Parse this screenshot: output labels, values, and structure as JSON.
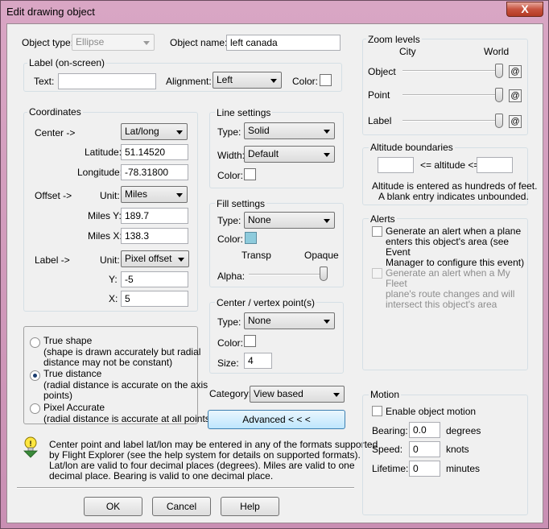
{
  "window": {
    "title": "Edit drawing object",
    "close_glyph": "X"
  },
  "object": {
    "type_label": "Object type:",
    "type_value": "Ellipse",
    "name_label": "Object name:",
    "name_value": "left canada"
  },
  "label_group": {
    "title": "Label (on-screen)",
    "text_label": "Text:",
    "text_value": "",
    "alignment_label": "Alignment:",
    "alignment_value": "Left",
    "color_label": "Color:"
  },
  "coordinates": {
    "title": "Coordinates",
    "center_label": "Center ->",
    "center_mode": "Lat/long",
    "latitude_label": "Latitude:",
    "latitude_value": "51.14520",
    "longitude_label": "Longitude:",
    "longitude_value": "-78.31800",
    "offset_label": "Offset ->",
    "unit_label": "Unit:",
    "offset_unit": "Miles",
    "miles_y_label": "Miles Y:",
    "miles_y_value": "189.7",
    "miles_x_label": "Miles X:",
    "miles_x_value": "138.3",
    "label_label": "Label ->",
    "label_unit": "Pixel offset",
    "y_label": "Y:",
    "y_value": "-5",
    "x_label": "X:",
    "x_value": "5"
  },
  "line_settings": {
    "title": "Line settings",
    "type_label": "Type:",
    "type_value": "Solid",
    "width_label": "Width:",
    "width_value": "Default",
    "color_label": "Color:"
  },
  "fill_settings": {
    "title": "Fill settings",
    "type_label": "Type:",
    "type_value": "None",
    "color_label": "Color:",
    "transp_label": "Transp",
    "opaque_label": "Opaque",
    "alpha_label": "Alpha:",
    "alpha_level": 1.0
  },
  "vertex": {
    "title": "Center / vertex point(s)",
    "type_label": "Type:",
    "type_value": "None",
    "color_label": "Color:",
    "size_label": "Size:",
    "size_value": "4"
  },
  "shape_mode": {
    "options": [
      {
        "title": "True shape",
        "desc1": "(shape is drawn accurately but radial",
        "desc2": "distance may not be constant)",
        "selected": false
      },
      {
        "title": "True distance",
        "desc1": "(radial distance is accurate on the axis",
        "desc2": "points)",
        "selected": true
      },
      {
        "title": "Pixel Accurate",
        "desc1": "(radial distance is accurate at all points)",
        "desc2": "",
        "selected": false
      }
    ]
  },
  "category": {
    "label": "Category:",
    "value": "View based"
  },
  "advanced_button": "Advanced  < < <",
  "info": {
    "line1": "Center point and label lat/lon may be entered in any of the formats supported",
    "line2": "by Flight Explorer (see the help system for details on supported formats).",
    "line3": "Lat/lon are valid to four decimal places (degrees).  Miles are valid to one",
    "line4": "decimal place.  Bearing is valid to one decimal place."
  },
  "buttons": {
    "ok": "OK",
    "cancel": "Cancel",
    "help": "Help"
  },
  "zoom": {
    "title": "Zoom levels",
    "city_label": "City",
    "world_label": "World",
    "rows": [
      {
        "label": "Object",
        "level": 1.0,
        "button": "@"
      },
      {
        "label": "Point",
        "level": 1.0,
        "button": "@"
      },
      {
        "label": "Label",
        "level": 1.0,
        "button": "@"
      }
    ]
  },
  "altitude": {
    "title": "Altitude boundaries",
    "min_value": "",
    "middle_label": "<= altitude <=",
    "max_value": "",
    "note1": "Altitude is entered as hundreds of feet.",
    "note2": "A blank entry indicates unbounded."
  },
  "alerts": {
    "title": "Alerts",
    "alert1_line1": "Generate an alert when a plane",
    "alert1_line2": "enters this object's area (see Event",
    "alert1_line3": "Manager to configure this event)",
    "alert2_line1": "Generate an alert when a My Fleet",
    "alert2_line2": "plane's route changes and will",
    "alert2_line3": "intersect this object's area"
  },
  "motion": {
    "title": "Motion",
    "enable_label": "Enable object motion",
    "bearing_label": "Bearing:",
    "bearing_value": "0.0",
    "bearing_unit": "degrees",
    "speed_label": "Speed:",
    "speed_value": "0",
    "speed_unit": "knots",
    "lifetime_label": "Lifetime:",
    "lifetime_value": "0",
    "lifetime_unit": "minutes"
  }
}
